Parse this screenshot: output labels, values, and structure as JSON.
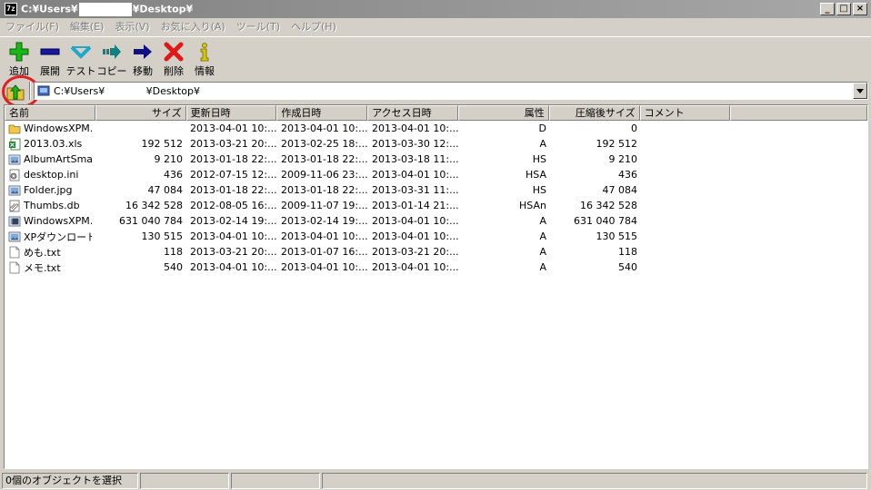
{
  "titlebar": {
    "icon_text": "7z",
    "title_prefix": "C:¥Users¥",
    "title_suffix": "¥Desktop¥",
    "minimize": "_",
    "maximize": "□",
    "close": "×"
  },
  "menu": [
    "ファイル(F)",
    "編集(E)",
    "表示(V)",
    "お気に入り(A)",
    "ツール(T)",
    "ヘルプ(H)"
  ],
  "toolbar": [
    {
      "label": "追加",
      "icon": "add-icon"
    },
    {
      "label": "展開",
      "icon": "extract-icon"
    },
    {
      "label": "テスト",
      "icon": "test-icon"
    },
    {
      "label": "コピー",
      "icon": "copy-icon"
    },
    {
      "label": "移動",
      "icon": "move-icon"
    },
    {
      "label": "削除",
      "icon": "delete-icon"
    },
    {
      "label": "情報",
      "icon": "info-icon"
    }
  ],
  "address": {
    "value": "C:¥Users¥             ¥Desktop¥"
  },
  "columns": [
    "名前",
    "サイズ",
    "更新日時",
    "作成日時",
    "アクセス日時",
    "属性",
    "圧縮後サイズ",
    "コメント"
  ],
  "files": [
    {
      "name": "WindowsXPM...",
      "size": "",
      "modified": "2013-04-01 10:...",
      "created": "2013-04-01 10:...",
      "accessed": "2013-04-01 10:...",
      "attr": "D",
      "packed": "0",
      "icon": "folder-icon"
    },
    {
      "name": "2013.03.xls",
      "size": "192 512",
      "modified": "2013-03-21 20:...",
      "created": "2013-02-25 18:...",
      "accessed": "2013-03-30 12:...",
      "attr": "A",
      "packed": "192 512",
      "icon": "excel-icon"
    },
    {
      "name": "AlbumArtSma...",
      "size": "9 210",
      "modified": "2013-01-18 22:...",
      "created": "2013-01-18 22:...",
      "accessed": "2013-03-18 11:...",
      "attr": "HS",
      "packed": "9 210",
      "icon": "image-icon"
    },
    {
      "name": "desktop.ini",
      "size": "436",
      "modified": "2012-07-15 12:...",
      "created": "2009-11-06 23:...",
      "accessed": "2013-04-01 10:...",
      "attr": "HSA",
      "packed": "436",
      "icon": "settings-file-icon"
    },
    {
      "name": "Folder.jpg",
      "size": "47 084",
      "modified": "2013-01-18 22:...",
      "created": "2013-01-18 22:...",
      "accessed": "2013-03-31 11:...",
      "attr": "HS",
      "packed": "47 084",
      "icon": "image-icon"
    },
    {
      "name": "Thumbs.db",
      "size": "16 342 528",
      "modified": "2012-08-05 16:...",
      "created": "2009-11-07 19:...",
      "accessed": "2013-01-14 21:...",
      "attr": "HSAn",
      "packed": "16 342 528",
      "icon": "db-file-icon"
    },
    {
      "name": "WindowsXPM...",
      "size": "631 040 784",
      "modified": "2013-02-14 19:...",
      "created": "2013-02-14 19:...",
      "accessed": "2013-04-01 10:...",
      "attr": "A",
      "packed": "631 040 784",
      "icon": "video-icon"
    },
    {
      "name": "XPダウンロード...",
      "size": "130 515",
      "modified": "2013-04-01 10:...",
      "created": "2013-04-01 10:...",
      "accessed": "2013-04-01 10:...",
      "attr": "A",
      "packed": "130 515",
      "icon": "image-icon"
    },
    {
      "name": "めも.txt",
      "size": "118",
      "modified": "2013-03-21 20:...",
      "created": "2013-01-07 16:...",
      "accessed": "2013-03-21 20:...",
      "attr": "A",
      "packed": "118",
      "icon": "text-file-icon"
    },
    {
      "name": "メモ.txt",
      "size": "540",
      "modified": "2013-04-01 10:...",
      "created": "2013-04-01 10:...",
      "accessed": "2013-04-01 10:...",
      "attr": "A",
      "packed": "540",
      "icon": "text-file-icon"
    }
  ],
  "status": {
    "selection": "0個のオブジェクトを選択",
    "cell2": "",
    "cell3": "",
    "cell4": ""
  },
  "colors": {
    "add": "#18b818",
    "extract": "#1818a0",
    "test": "#20a8c8",
    "copy": "#108080",
    "move": "#101080",
    "delete": "#e01818",
    "info": "#d8c800",
    "highlight_circle": "#e02020"
  }
}
